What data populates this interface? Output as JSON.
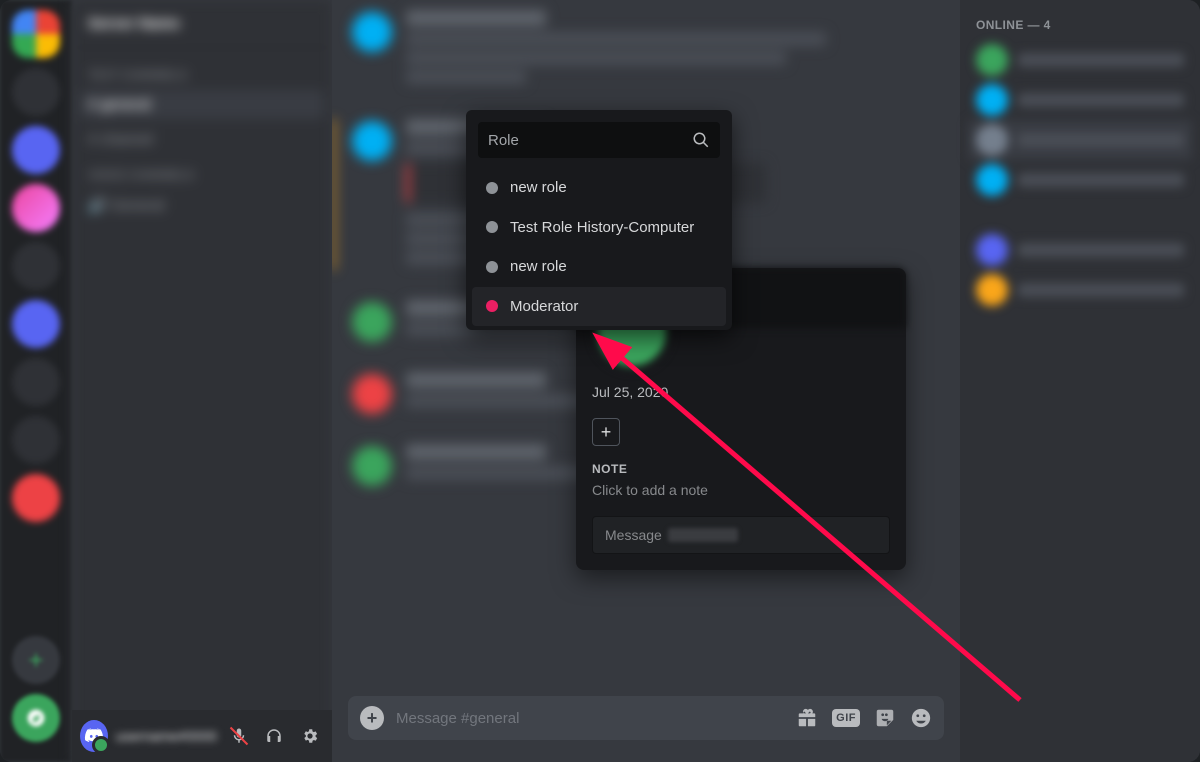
{
  "members_header": "ONLINE — 4",
  "role_picker": {
    "search_placeholder": "Role",
    "items": [
      {
        "label": "new role",
        "color": "grey"
      },
      {
        "label": "Test Role History-Computer",
        "color": "grey"
      },
      {
        "label": "new role",
        "color": "grey"
      },
      {
        "label": "Moderator",
        "color": "pink",
        "highlighted": true
      }
    ]
  },
  "profile": {
    "member_since": "Jul 25, 2020",
    "add_role_icon": "+",
    "note_label": "NOTE",
    "note_placeholder": "Click to add a note",
    "message_prefix": "Message"
  },
  "chat_input": {
    "placeholder": "Message #general",
    "gif_label": "GIF"
  },
  "icons": {
    "plus": "+"
  }
}
